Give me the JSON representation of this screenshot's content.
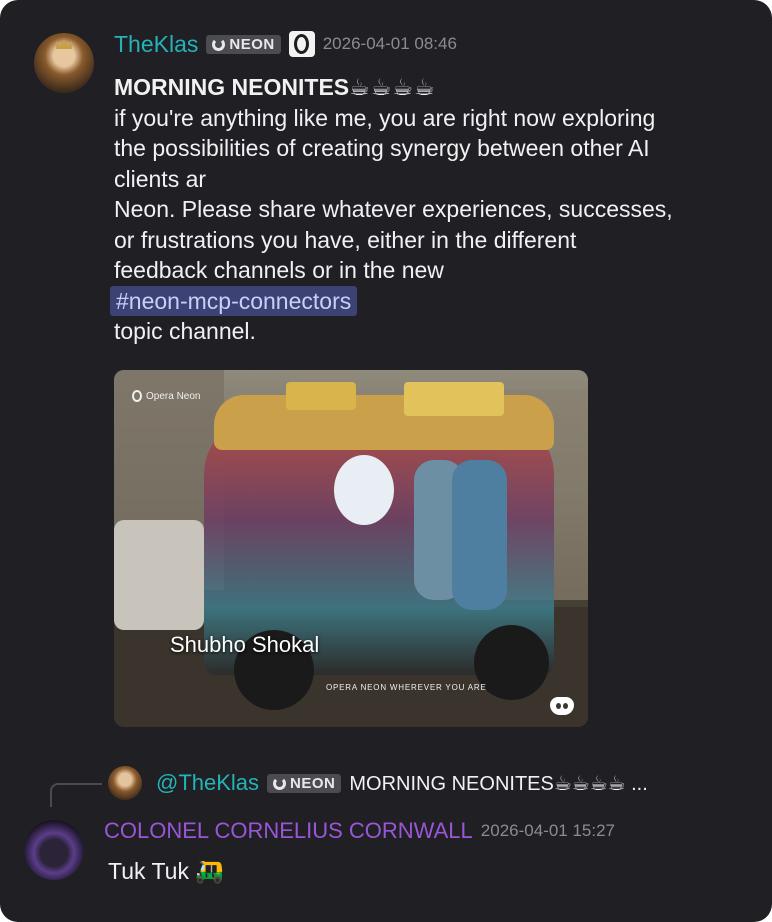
{
  "message1": {
    "username": "TheKlas",
    "badge_label": "NEON",
    "timestamp": "2026-04-01 08:46",
    "title": "MORNING NEONITES",
    "title_emoji": "☕☕☕☕",
    "line1": "if you're anything like me, you are right now exploring",
    "line2": "the possibilities of creating synergy between other AI",
    "line3": "clients ar",
    "line4": "Neon. Please share whatever experiences, successes,",
    "line5": "or frustrations you have, either in the different",
    "line6": "feedback channels or in the new",
    "channel_mention": "#neon-mcp-connectors",
    "line7": "topic channel.",
    "image": {
      "logo_text": "Opera Neon",
      "caption": "Shubho Shokal",
      "tagline": "OPERA NEON WHEREVER YOU ARE"
    }
  },
  "reply_preview": {
    "mention": "@TheKlas",
    "badge_label": "NEON",
    "snippet": "MORNING NEONITES☕☕☕☕ ..."
  },
  "message2": {
    "username": "COLONEL CORNELIUS CORNWALL",
    "timestamp": "2026-04-01 15:27",
    "text": "Tuk Tuk 🛺"
  },
  "icons": {
    "badge": "neon-ring-icon",
    "opera": "opera-logo-icon",
    "discord": "discord-logo-icon"
  },
  "colors": {
    "background": "#1f1f24",
    "username_teal": "#23b3b8",
    "username_purple": "#9a56d6",
    "mention_bg": "#3c4273"
  }
}
